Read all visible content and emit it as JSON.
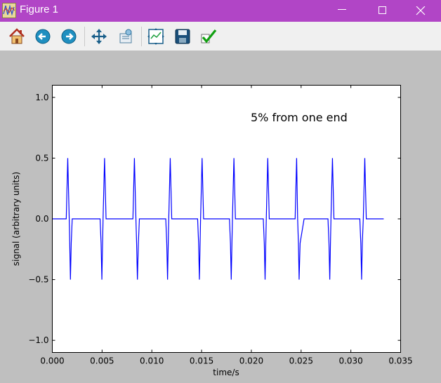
{
  "window": {
    "title": "Figure 1",
    "titlebar_color": "#b145c6"
  },
  "toolbar": {
    "buttons": [
      {
        "name": "home",
        "icon": "home-icon"
      },
      {
        "name": "back",
        "icon": "arrow-left-icon"
      },
      {
        "name": "forward",
        "icon": "arrow-right-icon"
      },
      {
        "name": "pan",
        "icon": "move-icon"
      },
      {
        "name": "zoom",
        "icon": "zoom-rect-icon"
      },
      {
        "name": "subplots",
        "icon": "configure-subplots-icon"
      },
      {
        "name": "save",
        "icon": "save-icon"
      },
      {
        "name": "edit",
        "icon": "checkmark-icon"
      }
    ]
  },
  "chart_data": {
    "type": "line",
    "title": "",
    "annotation": "5% from one end",
    "xlabel": "time/s",
    "ylabel": "signal (arbitrary units)",
    "xlim": [
      0.0,
      0.035
    ],
    "ylim": [
      -1.1,
      1.1
    ],
    "xticks": [
      "0.000",
      "0.005",
      "0.010",
      "0.015",
      "0.020",
      "0.025",
      "0.030",
      "0.035"
    ],
    "yticks": [
      "1.0",
      "0.5",
      "0.0",
      "−0.5",
      "−1.0"
    ],
    "xtick_values": [
      0.0,
      0.005,
      0.01,
      0.015,
      0.02,
      0.025,
      0.03,
      0.035
    ],
    "ytick_values": [
      1.0,
      0.5,
      0.0,
      -0.5,
      -1.0
    ],
    "line_color": "#0000ff",
    "grid": false,
    "series": [
      {
        "x": [
          0.0,
          0.0014,
          0.00155,
          0.0017,
          0.00175,
          0.00182,
          0.0019,
          0.002,
          0.0024,
          0.0044,
          0.0048,
          0.0049,
          0.00498,
          0.00505,
          0.0051,
          0.00525,
          0.0054,
          0.0056,
          0.0079,
          0.0081,
          0.00825,
          0.0084,
          0.00847,
          0.00855,
          0.00865,
          0.00875,
          0.0091,
          0.011,
          0.0114,
          0.0115,
          0.01158,
          0.01165,
          0.0117,
          0.01185,
          0.012,
          0.0122,
          0.0142,
          0.0146,
          0.0147,
          0.01478,
          0.01485,
          0.0149,
          0.01505,
          0.0152,
          0.0154,
          0.0174,
          0.0178,
          0.0179,
          0.01798,
          0.01805,
          0.0181,
          0.01825,
          0.0184,
          0.0186,
          0.0208,
          0.0212,
          0.0213,
          0.02138,
          0.02145,
          0.0215,
          0.02165,
          0.0218,
          0.022,
          0.0238,
          0.0242,
          0.0244,
          0.02455,
          0.02465,
          0.02473,
          0.0248,
          0.0249,
          0.0253,
          0.0273,
          0.0277,
          0.0278,
          0.02788,
          0.02795,
          0.028,
          0.02815,
          0.0283,
          0.0285,
          0.0305,
          0.0309,
          0.031,
          0.03108,
          0.03115,
          0.03125,
          0.0314,
          0.03155,
          0.03175,
          0.0333
        ],
        "y": [
          0.0,
          0.0,
          0.5,
          0.0,
          -0.2,
          -0.5,
          -0.2,
          0.0,
          0.0,
          0.0,
          0.0,
          -0.2,
          -0.5,
          -0.2,
          0.0,
          0.5,
          0.0,
          0.0,
          0.0,
          0.0,
          0.5,
          0.0,
          -0.2,
          -0.5,
          -0.2,
          0.0,
          0.0,
          0.0,
          0.0,
          -0.2,
          -0.5,
          -0.2,
          0.0,
          0.5,
          0.0,
          0.0,
          0.0,
          0.0,
          -0.2,
          -0.5,
          -0.2,
          0.0,
          0.5,
          0.0,
          0.0,
          0.0,
          0.0,
          -0.2,
          -0.5,
          -0.2,
          0.0,
          0.5,
          0.0,
          0.0,
          0.0,
          0.0,
          -0.2,
          -0.5,
          -0.2,
          0.0,
          0.5,
          0.0,
          0.0,
          0.0,
          0.0,
          0.0,
          0.5,
          0.0,
          -0.2,
          -0.5,
          -0.2,
          0.0,
          0.0,
          0.0,
          -0.2,
          -0.5,
          -0.2,
          0.0,
          0.5,
          0.0,
          0.0,
          0.0,
          0.0,
          -0.2,
          -0.5,
          -0.2,
          0.0,
          0.5,
          0.0,
          0.0,
          0.0
        ]
      }
    ]
  }
}
